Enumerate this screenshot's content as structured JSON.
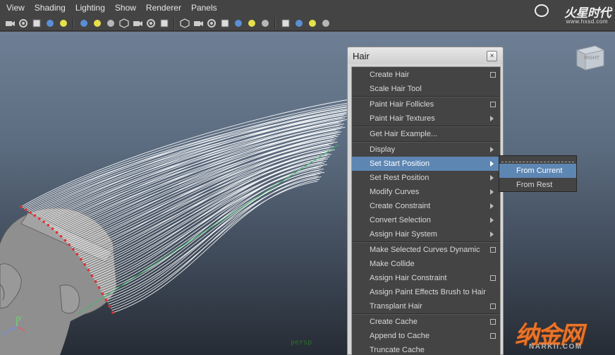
{
  "menubar": [
    "View",
    "Shading",
    "Lighting",
    "Show",
    "Renderer",
    "Panels"
  ],
  "toolbar": {
    "groups": [
      [
        "camera-attributes-icon",
        "camera-tools-icon",
        "bookmark-icon",
        "image-plane-icon",
        "grease-pencil-icon"
      ],
      [
        "grid-icon",
        "film-gate-icon",
        "resolution-gate-icon",
        "gate-mask-icon",
        "field-chart-icon",
        "safe-action-icon",
        "safe-title-icon"
      ],
      [
        "wireframe-icon",
        "smooth-shade-icon",
        "flat-shade-icon",
        "textured-icon",
        "use-lights-icon",
        "shadows-icon",
        "ambient-occlusion-icon"
      ],
      [
        "isolate-select-icon",
        "xray-icon",
        "xray-active-icon",
        "xray-joints-icon"
      ]
    ]
  },
  "logo": {
    "title": "火星时代",
    "url": "www.hxsd.com"
  },
  "viewport": {
    "camera_label": "persp",
    "viewcube_label": "RIGHT"
  },
  "axis": {
    "y": "y",
    "z": "z"
  },
  "brand": {
    "cn": "纳金网",
    "en": "NARKII.COM"
  },
  "hair_menu": {
    "title": "Hair",
    "close": "×",
    "sections": [
      [
        {
          "label": "Create Hair",
          "type": "option"
        },
        {
          "label": "Scale Hair Tool",
          "type": "plain"
        }
      ],
      [
        {
          "label": "Paint Hair Follicles",
          "type": "option"
        },
        {
          "label": "Paint Hair Textures",
          "type": "submenu"
        }
      ],
      [
        {
          "label": "Get Hair Example...",
          "type": "plain"
        }
      ],
      [
        {
          "label": "Display",
          "type": "submenu"
        },
        {
          "label": "Set Start Position",
          "type": "submenu",
          "active": true
        },
        {
          "label": "Set Rest Position",
          "type": "submenu"
        },
        {
          "label": "Modify Curves",
          "type": "submenu"
        },
        {
          "label": "Create Constraint",
          "type": "submenu"
        },
        {
          "label": "Convert Selection",
          "type": "submenu"
        },
        {
          "label": "Assign Hair System",
          "type": "submenu"
        }
      ],
      [
        {
          "label": "Make Selected Curves Dynamic",
          "type": "option"
        },
        {
          "label": "Make Collide",
          "type": "plain"
        },
        {
          "label": "Assign Hair Constraint",
          "type": "option"
        },
        {
          "label": "Assign Paint Effects Brush to Hair",
          "type": "plain"
        },
        {
          "label": "Transplant Hair",
          "type": "option"
        }
      ],
      [
        {
          "label": "Create Cache",
          "type": "option"
        },
        {
          "label": "Append to Cache",
          "type": "option"
        },
        {
          "label": "Truncate Cache",
          "type": "plain"
        }
      ]
    ]
  },
  "submenu": {
    "items": [
      {
        "label": "From Current",
        "active": true
      },
      {
        "label": "From Rest"
      }
    ]
  },
  "colors": {
    "menu_bg": "#444444",
    "highlight": "#5d86b3",
    "window_chrome": "#d6d6d6",
    "hair_curve": "#ffffff",
    "brand_orange": "#e8742a"
  }
}
